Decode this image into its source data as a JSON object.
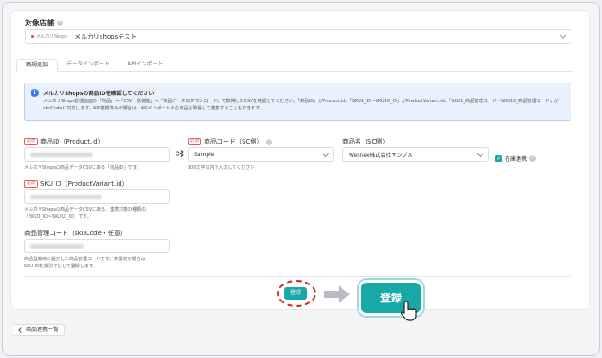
{
  "store": {
    "label": "対象店舗",
    "chip": "メルカリShops",
    "name": "メルカリshopsテスト"
  },
  "tabs": [
    {
      "label": "新規追加",
      "active": true
    },
    {
      "label": "データインポート",
      "active": false
    },
    {
      "label": "APIインポート",
      "active": false
    }
  ],
  "info": {
    "title": "メルカリShopsの商品IDを確認してください",
    "body": "メルカリShops管理画面の「商品」→「CSV一括機能」→「商品データのダウンロード」で取得したCSVを確認してください。「商品ID」がProduct.id、「SKU1_ID〜SKU10_ID」がProductVariant.id、「SKU1_商品管理コード〜SKU10_商品管理コード」がskuCodeに対応します。API連携済みの場合は、APIインポートから商品を取得して連携することもできます。"
  },
  "required_tag": "必須",
  "product_id": {
    "label": "商品ID（Product.id）",
    "help": "メルカリShopsの商品データCSVにある「商品ID」です。"
  },
  "product_code": {
    "label": "商品コード（SC側）",
    "value": "Sample",
    "help": "100文字以内で入力してください"
  },
  "product_name": {
    "label": "商品名（SC側）",
    "value": "Welinex株式会社サンプル"
  },
  "stock_link": {
    "label": "在庫連携",
    "checked": true
  },
  "sku_id": {
    "label": "SKU ID（ProductVariant.id）",
    "help1": "メルカリShopsの商品データCSVにある、連携対象の種類の",
    "help2": "「SKU1_ID〜SKU10_ID」です。"
  },
  "sku_code": {
    "label": "商品管理コード（skuCode・任意）",
    "help1": "商品登録時に設定した商品管理コードです。未設定の場合は、",
    "help2": "SKU IDを識別子として登録します。"
  },
  "buttons": {
    "register_small": "登録",
    "register_big": "登録",
    "back": "商品連携一覧"
  },
  "colors": {
    "accent": "#1aa7a8",
    "highlight": "#d62424",
    "info_bg": "#e9f1fc"
  }
}
